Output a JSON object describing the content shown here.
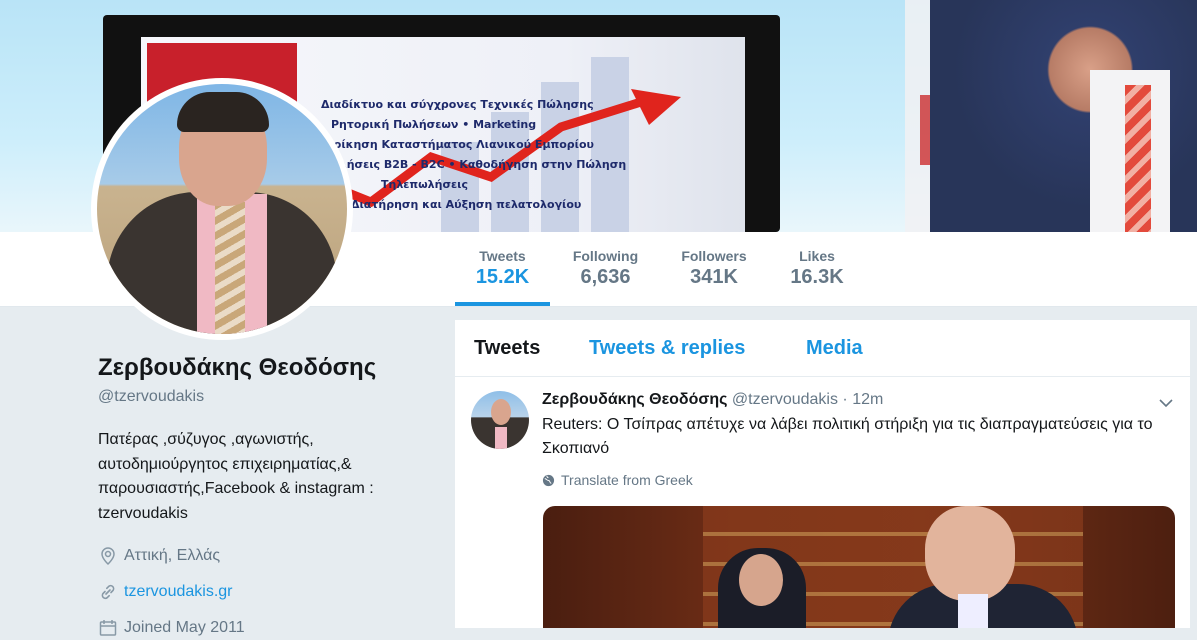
{
  "profile": {
    "name": "Ζερβουδάκης Θεοδόσης",
    "handle": "@tzervoudakis",
    "bio": "Πατέρας ,σύζυγος ,αγωνιστής, αυτοδημιούργητος επιχειρηματίας,& παρουσιαστής,Facebook & instagram : tzervoudakis",
    "location": "Αττική, Ελλάς",
    "website": "tzervoudakis.gr",
    "joined": "Joined May 2011"
  },
  "stats": [
    {
      "label": "Tweets",
      "value": "15.2K"
    },
    {
      "label": "Following",
      "value": "6,636"
    },
    {
      "label": "Followers",
      "value": "341K"
    },
    {
      "label": "Likes",
      "value": "16.3K"
    }
  ],
  "tabs": [
    "Tweets",
    "Tweets & replies",
    "Media"
  ],
  "tweet": {
    "name": "Ζερβουδάκης Θεοδόσης",
    "handle": "@tzervoudakis",
    "time": "· 12m",
    "text": "Reuters: Ο Τσίπρας απέτυχε να λάβει πολιτική στήριξη για τις διαπραγματεύσεις για το Σκοπιανό",
    "translate": "Translate from Greek"
  },
  "banner": {
    "screen_lines": [
      "Διαδίκτυο και σύγχρονες Τεχνικές Πώλησης",
      "Ρητορική Πωλήσεων  •  Marketing",
      "Διοίκηση Καταστήματος Λιανικού Εμπορίου",
      "Πωλήσεις B2B - B2C  •  Καθοδήγηση στην Πώληση",
      "Τηλεπωλήσεις",
      "Διατήρηση και Αύξηση πελατολογίου"
    ]
  },
  "colors": {
    "accent": "#1b95e0",
    "muted": "#657786",
    "text": "#14171a",
    "bg": "#e6ecf0"
  },
  "icons": [
    "location-pin-icon",
    "link-icon",
    "calendar-icon",
    "globe-icon",
    "chevron-down-icon"
  ]
}
